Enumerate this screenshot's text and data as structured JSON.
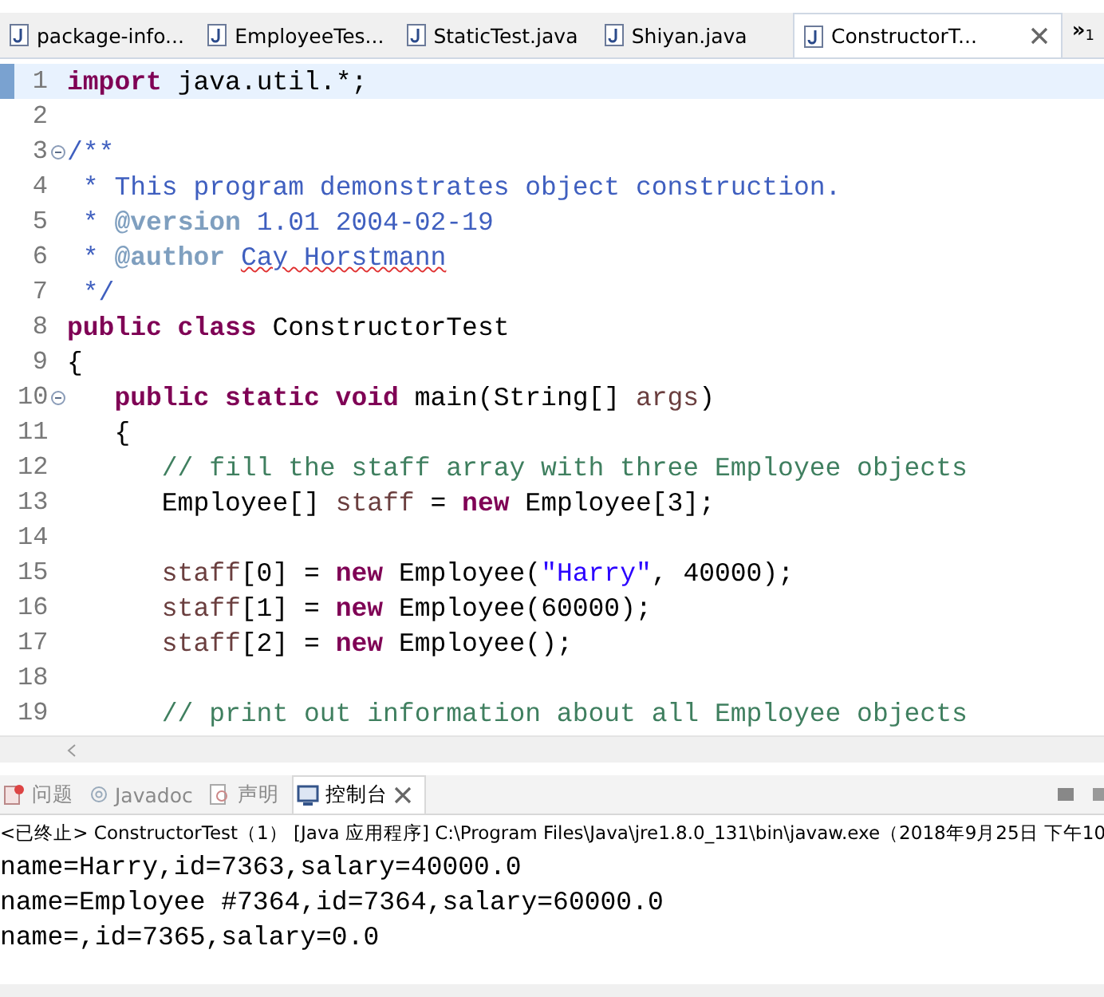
{
  "editor_tabs": [
    {
      "label": "package-info...",
      "selected": false
    },
    {
      "label": "EmployeeTes...",
      "selected": false
    },
    {
      "label": "StaticTest.java",
      "selected": false
    },
    {
      "label": "Shiyan.java",
      "selected": false
    },
    {
      "label": "ConstructorT...",
      "selected": true
    }
  ],
  "overflow": {
    "symbol": "»",
    "count": "1"
  },
  "code_lines": [
    {
      "number": "1",
      "kind": "top",
      "current": true,
      "fold": false,
      "tokens": [
        {
          "kind": "kw",
          "text": "import"
        },
        {
          "kind": "plain",
          "text": " java.util.*;"
        }
      ]
    },
    {
      "number": "2",
      "current": false,
      "fold": false
    },
    {
      "number": "3",
      "kind": "top",
      "current": false,
      "fold": true,
      "tokens": [
        {
          "kind": "doc",
          "text": "/**"
        }
      ]
    },
    {
      "number": "4",
      "kind": "top",
      "current": false,
      "fold": false,
      "tokens": [
        {
          "kind": "doc",
          "text": " * This program demonstrates object construction."
        }
      ]
    },
    {
      "number": "5",
      "kind": "top",
      "current": false,
      "fold": false,
      "tokens": [
        {
          "kind": "doc",
          "text": " * "
        },
        {
          "kind": "doctag",
          "text": "@version"
        },
        {
          "kind": "doc",
          "text": " 1.01 2004-02-19"
        }
      ]
    },
    {
      "number": "6",
      "kind": "top",
      "current": false,
      "fold": false,
      "tokens": [
        {
          "kind": "doc",
          "text": " * "
        },
        {
          "kind": "doctag",
          "text": "@author "
        },
        {
          "kind": "misspelled",
          "text": "Cay Horstmann"
        }
      ]
    },
    {
      "number": "7",
      "kind": "top",
      "current": false,
      "fold": false,
      "tokens": [
        {
          "kind": "doc",
          "text": " */"
        }
      ]
    },
    {
      "number": "8",
      "kind": "top",
      "current": false,
      "fold": false,
      "tokens": [
        {
          "kind": "kw",
          "text": "public class"
        },
        {
          "kind": "plain",
          "text": " ConstructorTest"
        }
      ]
    },
    {
      "number": "9",
      "kind": "top",
      "current": false,
      "fold": false,
      "tokens": [
        {
          "kind": "plain",
          "text": "{"
        }
      ]
    },
    {
      "number": "10",
      "kind": "member",
      "current": false,
      "fold": true,
      "tokens": [
        {
          "kind": "kw",
          "text": "public static void"
        },
        {
          "kind": "plain",
          "text": " main(String[] "
        },
        {
          "kind": "param",
          "text": "args"
        },
        {
          "kind": "plain",
          "text": ")"
        }
      ]
    },
    {
      "number": "11",
      "kind": "member",
      "current": false,
      "fold": false,
      "tokens": [
        {
          "kind": "plain",
          "text": "{"
        }
      ]
    },
    {
      "number": "12",
      "kind": "body",
      "current": false,
      "fold": false,
      "tokens": [
        {
          "kind": "comment",
          "text": "// fill the staff array with three Employee objects"
        }
      ]
    },
    {
      "number": "13",
      "kind": "body",
      "current": false,
      "fold": false,
      "tokens": [
        {
          "kind": "plain",
          "text": "Employee[] "
        },
        {
          "kind": "local",
          "text": "staff"
        },
        {
          "kind": "plain",
          "text": " = "
        },
        {
          "kind": "kw",
          "text": "new"
        },
        {
          "kind": "plain",
          "text": " Employee[3];"
        }
      ]
    },
    {
      "number": "14",
      "current": false,
      "fold": false
    },
    {
      "number": "15",
      "kind": "body",
      "current": false,
      "fold": false,
      "tokens": [
        {
          "kind": "local",
          "text": "staff"
        },
        {
          "kind": "plain",
          "text": "[0] = "
        },
        {
          "kind": "kw",
          "text": "new"
        },
        {
          "kind": "plain",
          "text": " Employee("
        },
        {
          "kind": "str",
          "text": "\"Harry\""
        },
        {
          "kind": "plain",
          "text": ", 40000);"
        }
      ]
    },
    {
      "number": "16",
      "kind": "body",
      "current": false,
      "fold": false,
      "tokens": [
        {
          "kind": "local",
          "text": "staff"
        },
        {
          "kind": "plain",
          "text": "[1] = "
        },
        {
          "kind": "kw",
          "text": "new"
        },
        {
          "kind": "plain",
          "text": " Employee(60000);"
        }
      ]
    },
    {
      "number": "17",
      "kind": "body",
      "current": false,
      "fold": false,
      "tokens": [
        {
          "kind": "local",
          "text": "staff"
        },
        {
          "kind": "plain",
          "text": "[2] = "
        },
        {
          "kind": "kw",
          "text": "new"
        },
        {
          "kind": "plain",
          "text": " Employee();"
        }
      ]
    },
    {
      "number": "18",
      "current": false,
      "fold": false
    },
    {
      "number": "19",
      "kind": "body",
      "current": false,
      "fold": false,
      "tokens": [
        {
          "kind": "comment",
          "text": "// print out information about all Employee objects"
        }
      ]
    }
  ],
  "view_tabs": [
    {
      "kind": "problems",
      "label": "问题",
      "selected": false
    },
    {
      "kind": "javadoc",
      "label": "Javadoc",
      "selected": false
    },
    {
      "kind": "declaration",
      "label": "声明",
      "selected": false
    },
    {
      "kind": "console",
      "label": "控制台",
      "selected": true
    }
  ],
  "console_status": "<已终止> ConstructorTest（1） [Java 应用程序] C:\\Program Files\\Java\\jre1.8.0_131\\bin\\javaw.exe（2018年9月25日 下午10",
  "console_output": [
    "name=Harry,id=7363,salary=40000.0",
    "name=Employee #7364,id=7364,salary=60000.0",
    "name=,id=7365,salary=0.0"
  ]
}
